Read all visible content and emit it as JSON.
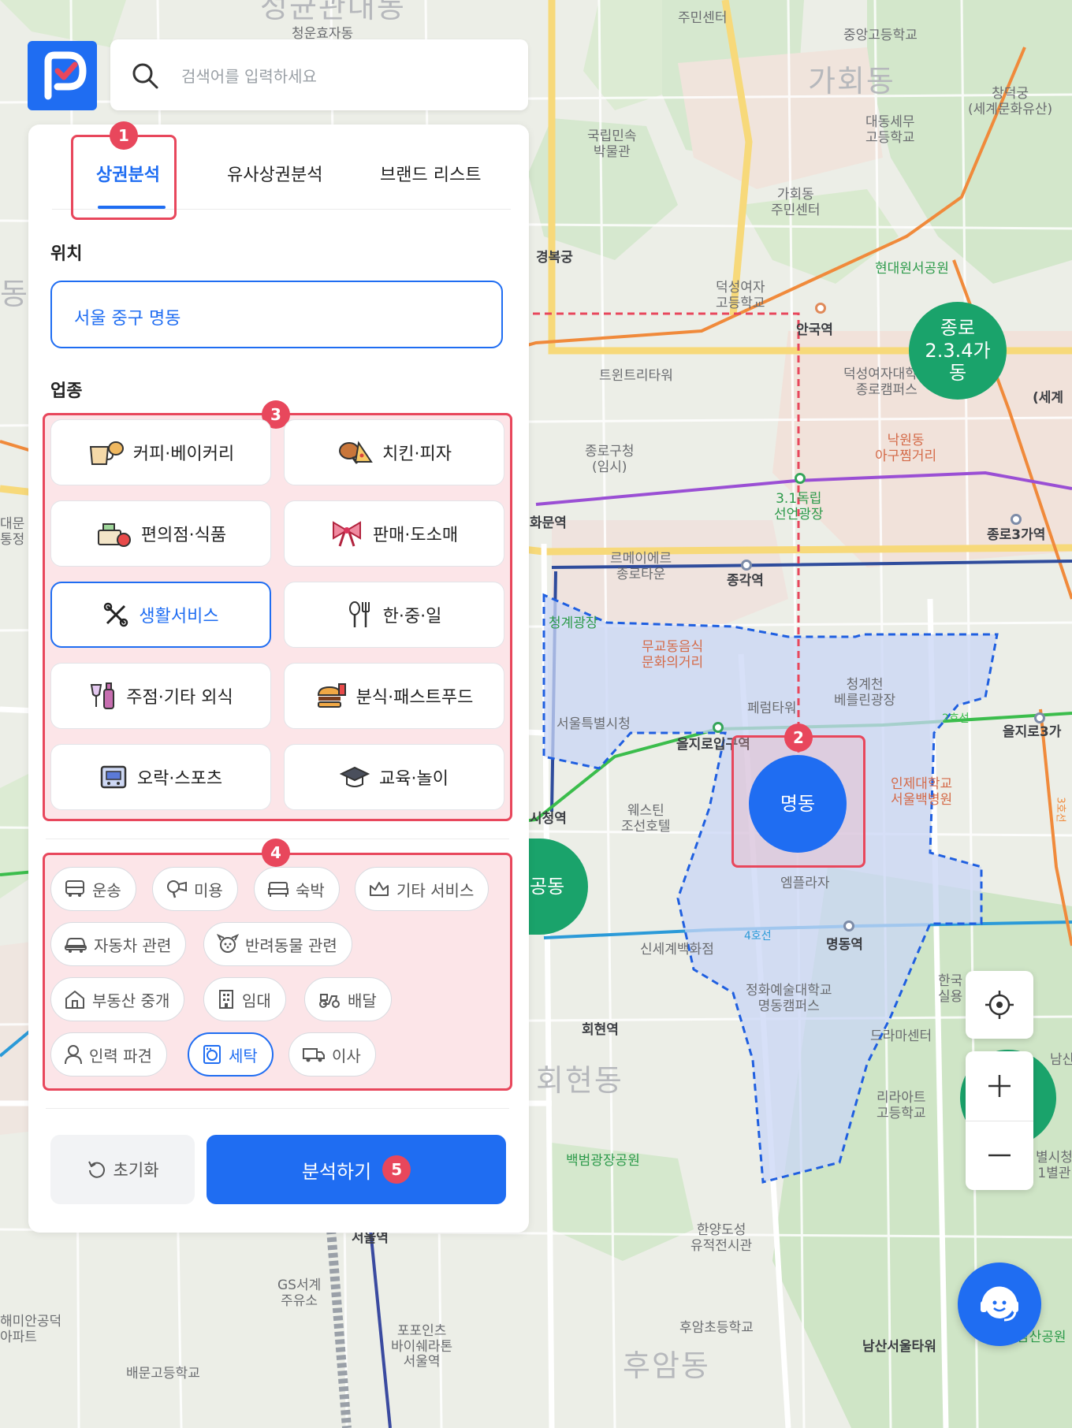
{
  "search": {
    "placeholder": "검색어를 입력하세요"
  },
  "tabs": [
    {
      "label": "상권분석",
      "active": true
    },
    {
      "label": "유사상권분석",
      "active": false
    },
    {
      "label": "브랜드 리스트",
      "active": false
    }
  ],
  "location": {
    "label": "위치",
    "value": "서울 중구 명동"
  },
  "category": {
    "label": "업종",
    "items": [
      {
        "label": "커피·베이커리",
        "icon": "coffee-bakery-icon"
      },
      {
        "label": "치킨·피자",
        "icon": "chicken-pizza-icon"
      },
      {
        "label": "편의점·식품",
        "icon": "grocery-icon"
      },
      {
        "label": "판매·도소매",
        "icon": "gift-bow-icon"
      },
      {
        "label": "생활서비스",
        "icon": "tools-icon",
        "active": true
      },
      {
        "label": "한·중·일",
        "icon": "utensils-icon"
      },
      {
        "label": "주점·기타 외식",
        "icon": "bottle-icon"
      },
      {
        "label": "분식·패스트푸드",
        "icon": "burger-icon"
      },
      {
        "label": "오락·스포츠",
        "icon": "game-icon"
      },
      {
        "label": "교육·놀이",
        "icon": "graduation-cap-icon"
      }
    ]
  },
  "subcategory": {
    "items": [
      {
        "label": "운송",
        "icon": "bus-icon"
      },
      {
        "label": "미용",
        "icon": "hair-dryer-icon"
      },
      {
        "label": "숙박",
        "icon": "bed-icon"
      },
      {
        "label": "기타 서비스",
        "icon": "crown-icon"
      },
      {
        "label": "자동차 관련",
        "icon": "car-icon"
      },
      {
        "label": "반려동물 관련",
        "icon": "dog-icon"
      },
      {
        "label": "부동산 중개",
        "icon": "house-icon"
      },
      {
        "label": "임대",
        "icon": "building-icon"
      },
      {
        "label": "배달",
        "icon": "scooter-icon"
      },
      {
        "label": "인력 파견",
        "icon": "person-icon"
      },
      {
        "label": "세탁",
        "icon": "washing-machine-icon",
        "active": true
      },
      {
        "label": "이사",
        "icon": "truck-icon"
      }
    ]
  },
  "actions": {
    "reset": "초기화",
    "analyze": "분석하기"
  },
  "annotations": [
    "1",
    "2",
    "3",
    "4",
    "5"
  ],
  "map": {
    "selected_area": "명동",
    "circles": [
      {
        "label": "종로\n2.3.4가\n동",
        "color": "#1aa36b"
      },
      {
        "label": "공동",
        "color": "#1aa36b"
      }
    ],
    "labels": [
      "성균관대동",
      "청운효자동",
      "주민센터",
      "중앙고등학교",
      "가회동",
      "창덕궁\n(세계문화유산)",
      "국립민속\n박물관",
      "대동세무\n고등학교",
      "가회동\n주민센터",
      "경복궁",
      "현대원서공원",
      "덕성여자\n고등학교",
      "안국역",
      "트윈트리타워",
      "덕성여자대학교\n종로캠퍼스",
      "(세계",
      "종로구청\n(임시)",
      "낙원동\n아구찜거리",
      "3.1독립\n선언광장",
      "화문역",
      "종로3가역",
      "르메이에르\n종로타운",
      "종각역",
      "청계광장",
      "무교동음식\n문화의거리",
      "청계천\n베를린광장",
      "서울특별시청",
      "페럼타워",
      "을지로입구역",
      "을지로3가",
      "인제대학교\n서울백병원",
      "시청역",
      "웨스틴\n조선호텔",
      "엠플라자",
      "명동역",
      "신세계백화점",
      "정화예술대학교\n명동캠퍼스",
      "회현역",
      "드라마센터",
      "한국\n실용",
      "리라아트\n고등학교",
      "회현동",
      "백범광장공원",
      "서울역",
      "GS서계\n주유소",
      "한양도성\n유적전시관",
      "포포인츠\n바이쉐라톤\n서울역",
      "후암초등학교",
      "후암동",
      "남산서울타워",
      "남산공원",
      "배문고등학교",
      "해미안공덕\n아파트",
      "대문\n통정",
      "동",
      "4호선",
      "2호선",
      "3호선",
      "남산",
      "별시청\n1별관"
    ]
  },
  "colors": {
    "brand_blue": "#1f6df2",
    "annotation_red": "#e8475c",
    "district_green": "#1aa36b",
    "area_fill": "#c9d6f5"
  }
}
